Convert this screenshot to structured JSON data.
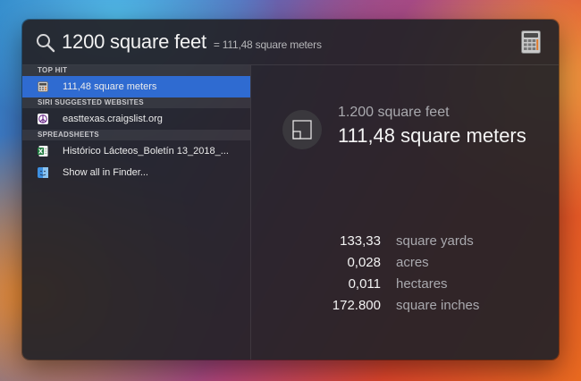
{
  "search": {
    "query": "1200 square feet",
    "inline_result": "= 111,48 square meters"
  },
  "sections": {
    "top_hit": "TOP HIT",
    "siri_websites": "SIRI SUGGESTED WEBSITES",
    "spreadsheets": "SPREADSHEETS"
  },
  "results": {
    "top_hit": {
      "label": "111,48 square meters",
      "icon": "calculator-icon"
    },
    "website": {
      "label": "easttexas.craigslist.org",
      "icon": "peace-icon"
    },
    "spreadsheet": {
      "label": "Histórico Lácteos_Boletín 13_2018_...",
      "icon": "excel-icon"
    },
    "show_all": {
      "label": "Show all in Finder...",
      "icon": "finder-icon"
    }
  },
  "preview": {
    "from": "1.200 square feet",
    "to": "111,48 square meters",
    "conversions": [
      {
        "value": "133,33",
        "unit": "square yards"
      },
      {
        "value": "0,028",
        "unit": "acres"
      },
      {
        "value": "0,011",
        "unit": "hectares"
      },
      {
        "value": "172.800",
        "unit": "square inches"
      }
    ]
  },
  "colors": {
    "selection": "#2f6bd1",
    "panel": "#242228"
  }
}
